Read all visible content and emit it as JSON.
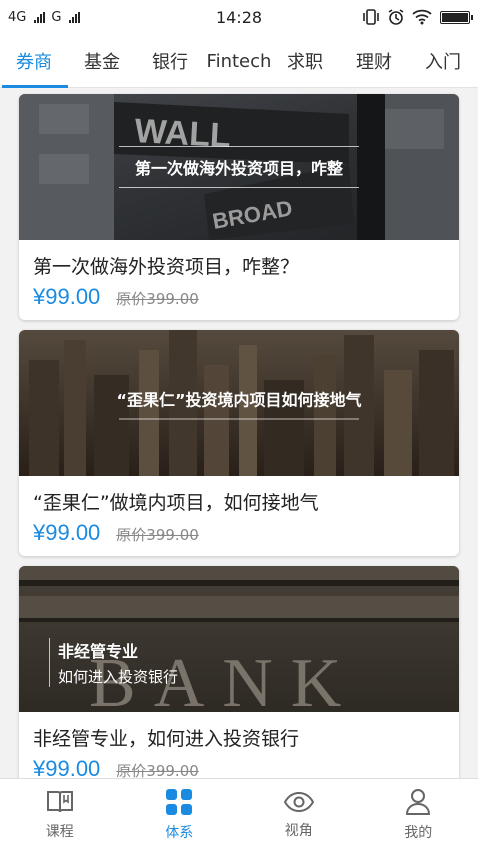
{
  "status_bar": {
    "network_1": "4G",
    "network_2": "G",
    "time": "14:28"
  },
  "tabs": [
    {
      "label": "券商",
      "active": true
    },
    {
      "label": "基金",
      "active": false
    },
    {
      "label": "银行",
      "active": false
    },
    {
      "label": "Fintech",
      "active": false
    },
    {
      "label": "求职",
      "active": false
    },
    {
      "label": "理财",
      "active": false
    },
    {
      "label": "入门",
      "active": false
    }
  ],
  "cards": [
    {
      "image_caption": "第一次做海外投资项目，咋整",
      "title": "第一次做海外投资项目，咋整？",
      "price": "¥99.00",
      "original_price": "原价399.00"
    },
    {
      "image_caption": "“歪果仁”投资境内项目如何接地气",
      "title": "“歪果仁”做境内项目，如何接地气",
      "price": "¥99.00",
      "original_price": "原价399.00"
    },
    {
      "image_caption_line1": "非经管专业",
      "image_caption_line2": "如何进入投资银行",
      "title": "非经管专业，如何进入投资银行",
      "price": "¥99.00",
      "original_price": "原价399.00"
    }
  ],
  "bottom_nav": [
    {
      "label": "课程",
      "icon": "book-icon",
      "active": false
    },
    {
      "label": "体系",
      "icon": "grid-icon",
      "active": true
    },
    {
      "label": "视角",
      "icon": "eye-icon",
      "active": false
    },
    {
      "label": "我的",
      "icon": "person-icon",
      "active": false
    }
  ],
  "colors": {
    "accent": "#1a8be0",
    "text": "#222222",
    "muted": "#888888"
  }
}
